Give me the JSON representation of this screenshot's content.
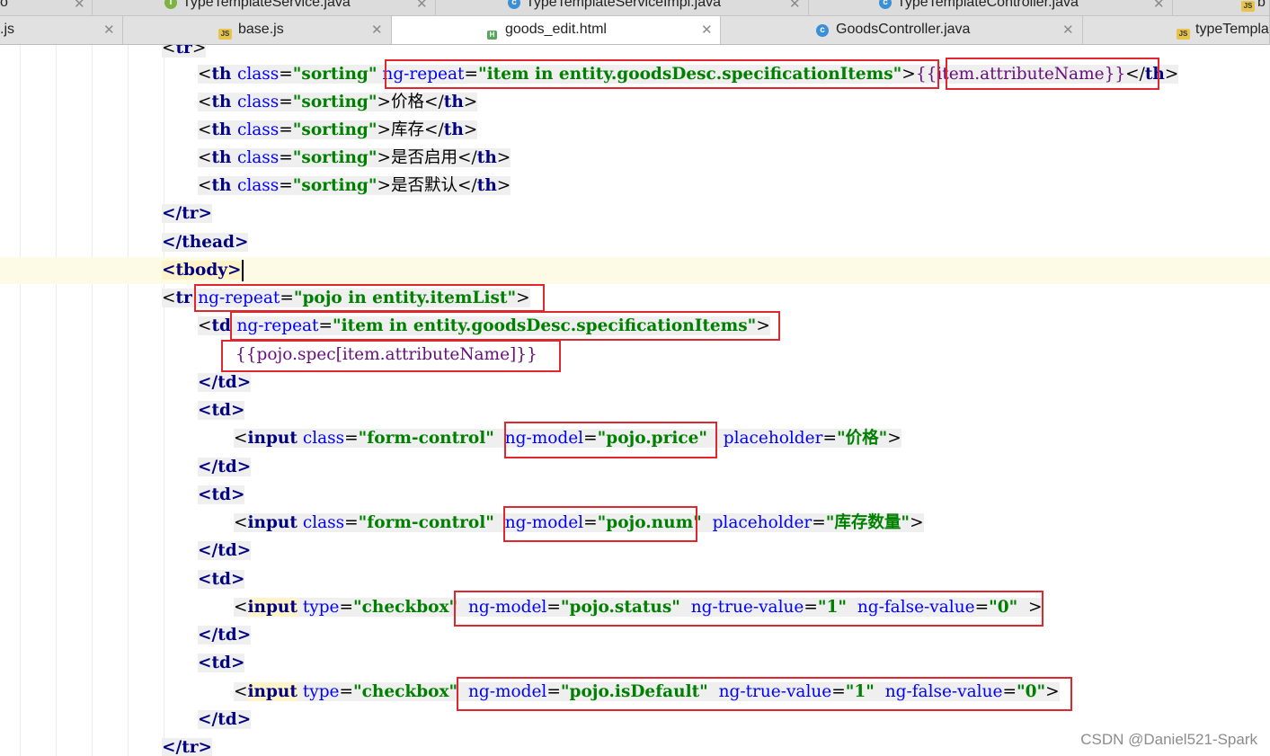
{
  "tabs_top": [
    {
      "label": "o"
    },
    {
      "label": "TypeTemplateService.java",
      "icon": "interface-icon"
    },
    {
      "label": "TypeTemplateServiceImpl.java",
      "icon": "class-icon"
    },
    {
      "label": "TypeTemplateController.java",
      "icon": "class-icon"
    },
    {
      "label": "b",
      "icon": "js-icon"
    }
  ],
  "tabs_bottom": [
    {
      "label": ".js"
    },
    {
      "label": "base.js",
      "icon": "js-icon"
    },
    {
      "label": "goods_edit.html",
      "icon": "html-icon",
      "active": true
    },
    {
      "label": "GoodsController.java",
      "icon": "class-icon"
    },
    {
      "label": "typeTempla",
      "icon": "js-icon"
    }
  ],
  "code": {
    "tr_open_top": "<tr>",
    "th_class": "class",
    "th_sorting": "\"sorting\"",
    "ng_repeat_specs": "ng-repeat",
    "spec_expr": "\"item in entity.goodsDesc.specificationItems\"",
    "attr_name_expr": "{{item.attributeName}}",
    "price_label": "价格",
    "stock_label": "库存",
    "enabled_label": "是否启用",
    "default_label": "是否默认",
    "tr_close": "</tr>",
    "thead_close": "</thead>",
    "tbody_open": "<tbody>",
    "tr_repeat_attr": "ng-repeat",
    "tr_repeat_val": "\"pojo in entity.itemList\"",
    "td_repeat_val": "\"item in entity.goodsDesc.specificationItems\"",
    "spec_value_expr": "{{pojo.spec[item.attributeName]}}",
    "td_close": "</td>",
    "td_open": "<td>",
    "input_tag": "input",
    "form_control": "\"form-control\"",
    "ng_model": "ng-model",
    "model_price": "\"pojo.price\"",
    "placeholder_attr": "placeholder",
    "placeholder_price": "\"价格\"",
    "model_num": "\"pojo.num\"",
    "placeholder_stock": "\"库存数量\"",
    "type_attr": "type",
    "checkbox": "\"checkbox\"",
    "model_status": "\"pojo.status\"",
    "true_value_attr": "ng-true-value",
    "false_value_attr": "ng-false-value",
    "one": "\"1\"",
    "zero": "\"0\"",
    "model_default": "\"pojo.isDefault\"",
    "tr_close_bottom": "</tr>"
  },
  "watermark": "CSDN @Daniel521-Spark"
}
